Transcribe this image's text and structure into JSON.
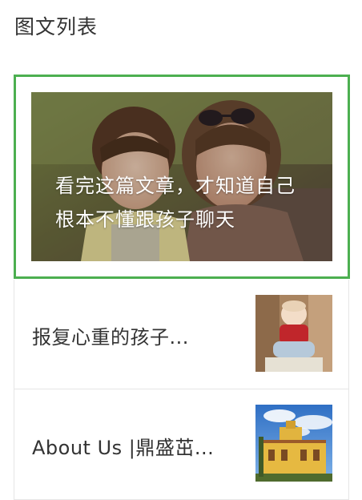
{
  "section": {
    "title": "图文列表"
  },
  "featured": {
    "caption": "看完这篇文章，才知道自己根本不懂跟孩子聊天",
    "image": "mother-and-child-photo",
    "highlight_color": "#4caf50"
  },
  "list": {
    "items": [
      {
        "title": "报复心重的孩子...",
        "thumbnail": "crying-toddler-photo"
      },
      {
        "title": "About Us |鼎盛茁...",
        "thumbnail": "yellow-building-photo"
      }
    ]
  }
}
